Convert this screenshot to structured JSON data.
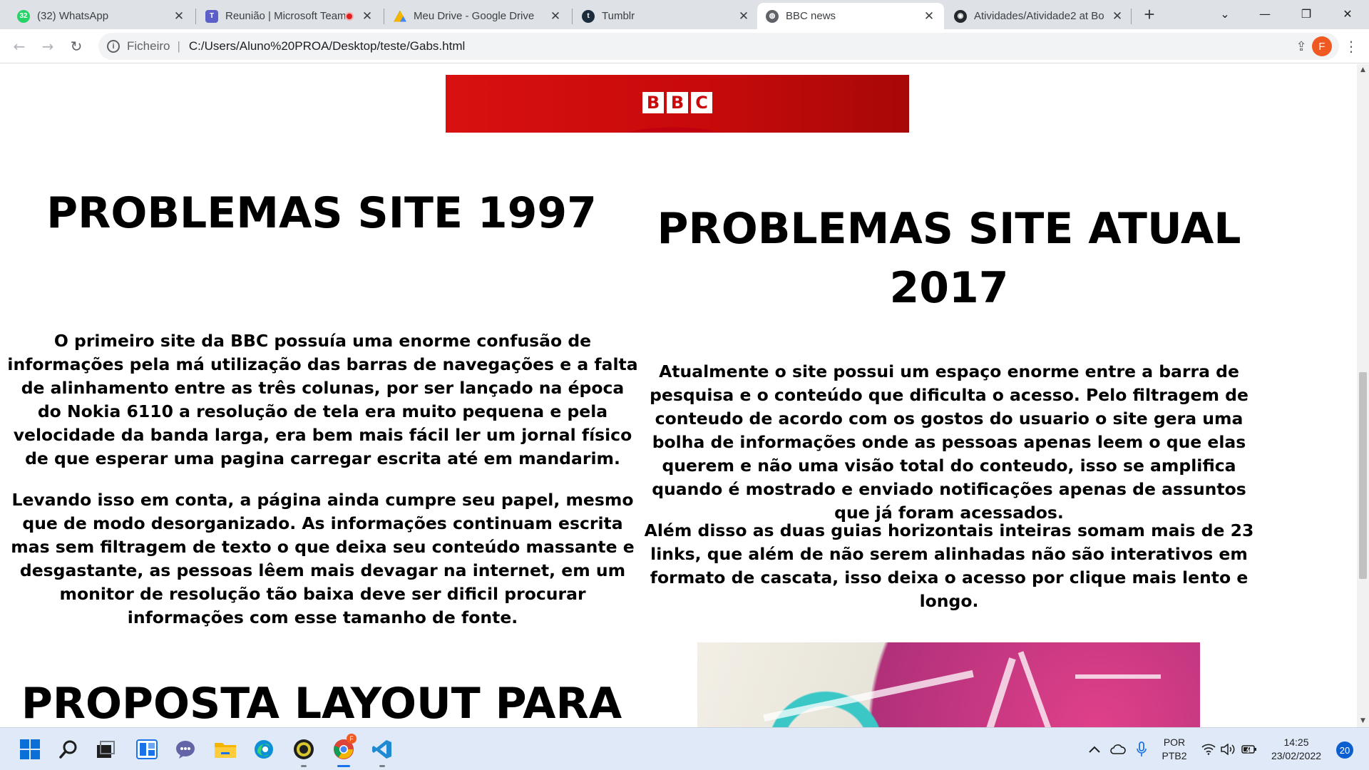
{
  "browser": {
    "tabs": [
      {
        "title": "(32) WhatsApp",
        "icon": "whatsapp-icon",
        "badge": "32",
        "close": "✕"
      },
      {
        "title": "Reunião | Microsoft Teams",
        "icon": "teams-icon",
        "close": "✕"
      },
      {
        "title": "Meu Drive - Google Drive",
        "icon": "google-drive-icon",
        "close": "✕"
      },
      {
        "title": "Tumblr",
        "icon": "tumblr-icon",
        "close": "✕"
      },
      {
        "title": "BBC news",
        "icon": "globe-icon",
        "close": "✕"
      },
      {
        "title": "Atividades/Atividade2 at Bo",
        "icon": "github-icon",
        "close": "✕"
      }
    ],
    "active_tab_index": 4,
    "new_tab_label": "+",
    "address": {
      "scheme_label": "Ficheiro",
      "separator": "|",
      "url": "C:/Users/Aluno%20PROA/Desktop/teste/Gabs.html"
    },
    "profile_initial": "F"
  },
  "page": {
    "banner": {
      "logo_letters": [
        "B",
        "B",
        "C"
      ]
    },
    "col_1997": {
      "heading": "PROBLEMAS SITE 1997",
      "paragraph_1": "O primeiro site da BBC possuía uma enorme confusão de informações pela má utilização das barras de navegações e a falta de alinhamento entre as três colunas, por ser lançado na época do Nokia 6110 a resolução de tela era muito pequena e pela velocidade da banda larga, era bem mais fácil ler um jornal físico de que esperar uma pagina carregar escrita até em mandarim.",
      "paragraph_2": "Levando isso em conta, a página ainda cumpre seu papel, mesmo que de modo desorganizado. As informações continuam escrita mas sem filtragem de texto o que deixa seu conteúdo massante e desgastante, as pessoas lêem mais devagar na internet, em um monitor de resolução tão baixa deve ser dificil procurar informações com esse tamanho de fonte."
    },
    "col_atual": {
      "heading": "PROBLEMAS SITE ATUAL 2017",
      "paragraph_1": "Atualmente o site possui um espaço enorme entre a barra de pesquisa e o conteúdo que dificulta o acesso. Pelo filtragem de conteudo de acordo com os gostos do usuario o site gera uma bolha de informações onde as pessoas apenas leem o que elas querem e não uma visão total do conteudo, isso se amplifica quando é mostrado e enviado notificações apenas de assuntos que já foram acessados.",
      "paragraph_2": "Além disso as duas guias horizontais inteiras somam mais de 23 links, que além de não serem alinhadas não são interativos em formato de cascata, isso deixa o acesso por clique mais lento e longo."
    },
    "proposta_heading": "PROPOSTA LAYOUT PARA"
  },
  "taskbar": {
    "apps": [
      "windows-start-icon",
      "search-icon",
      "task-view-icon",
      "widgets-icon",
      "teams-chat-icon",
      "file-explorer-icon",
      "edge-icon",
      "app-circle-icon",
      "chrome-icon",
      "vscode-icon"
    ],
    "chrome_badge": "F",
    "language_line1": "POR",
    "language_line2": "PTB2",
    "time": "14:25",
    "date": "23/02/2022",
    "notification_count": "20"
  },
  "colors": {
    "bbc_red": "#c80a0a",
    "profile_orange": "#f05a22",
    "taskbar_bg": "#dfe9f7",
    "notification_blue": "#0b5fce"
  }
}
